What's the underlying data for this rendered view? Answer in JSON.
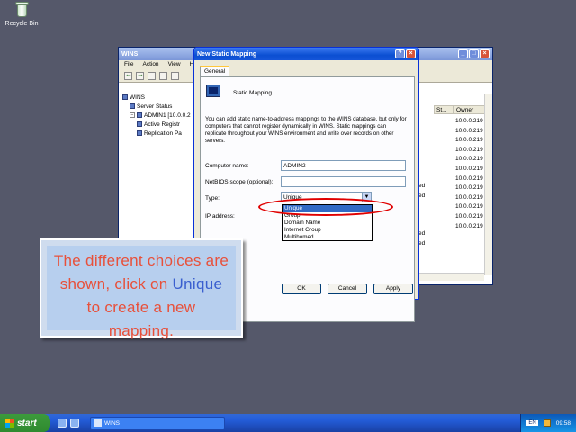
{
  "desktop": {
    "recycle_bin": "Recycle Bin"
  },
  "wins_window": {
    "title": "WINS",
    "menu": [
      "File",
      "Action",
      "View",
      "H"
    ],
    "tree": [
      {
        "label": "WINS",
        "indent": 0
      },
      {
        "label": "Server Status",
        "indent": 1
      },
      {
        "label": "ADMIN1 [10.0.0.2",
        "indent": 1
      },
      {
        "label": "Active Registr",
        "indent": 2
      },
      {
        "label": "Replication Pa",
        "indent": 2
      }
    ],
    "columns": [
      "St...",
      "Owner"
    ],
    "owners": [
      "10.0.0.219",
      "10.0.0.219",
      "10.0.0.219",
      "10.0.0.219",
      "10.0.0.219",
      "10.0.0.219",
      "10.0.0.219",
      "10.0.0.219",
      "10.0.0.219",
      "10.0.0.219",
      "10.0.0.219",
      "10.0.0.219"
    ],
    "partial_status": [
      "ed",
      "ed",
      "",
      "",
      "",
      "ed",
      "ed"
    ]
  },
  "dialog": {
    "title": "New Static Mapping",
    "tab": "General",
    "heading": "Static Mapping",
    "description": "You can add static name-to-address mappings to the WINS database, but only for computers that cannot register dynamically in WINS. Static mappings can replicate throughout your WINS environment and write over records on other servers.",
    "computer_name_label": "Computer name:",
    "computer_name_value": "ADMIN2",
    "netbios_label": "NetBIOS scope (optional):",
    "netbios_value": "",
    "type_label": "Type:",
    "type_value": "Unique",
    "ip_label": "IP address:",
    "type_options": [
      "Unique",
      "Group",
      "Domain Name",
      "Internet Group",
      "Multihomed"
    ],
    "selected_option": "Unique",
    "buttons": {
      "ok": "OK",
      "cancel": "Cancel",
      "apply": "Apply"
    }
  },
  "callout": {
    "text_before": "The different choices are shown, click on ",
    "highlight": "Unique",
    "text_after": " to create a new mapping.",
    "text_color": "#e8503a",
    "highlight_color": "#3a5fcf"
  },
  "taskbar": {
    "start_label": "start",
    "task_label": "WINS",
    "language": "EN",
    "clock": "09:58"
  }
}
